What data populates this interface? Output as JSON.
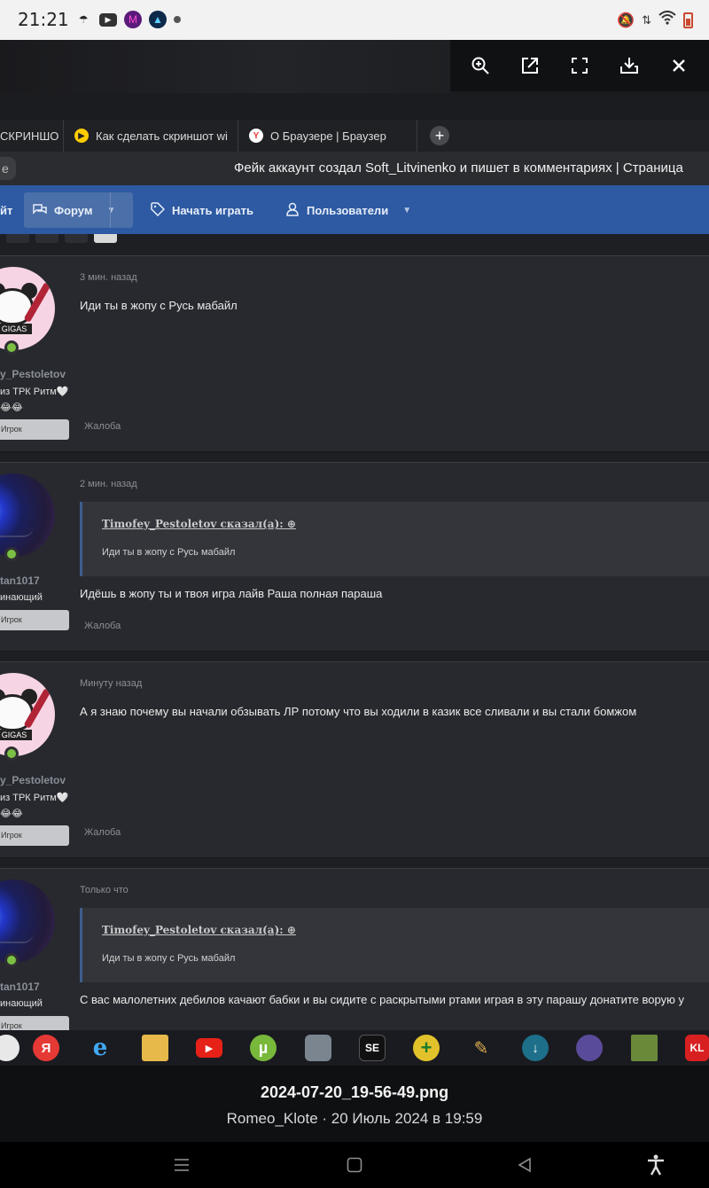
{
  "status_bar": {
    "time": "21:21",
    "icons": [
      "umbrella-icon",
      "youtube-icon",
      "app-icon-purple",
      "app-icon-blue",
      "dot-icon"
    ],
    "right_icons": [
      "mute-icon",
      "data-icon",
      "wifi-icon",
      "battery-icon"
    ]
  },
  "viewer": {
    "actions": [
      "zoom-in-icon",
      "open-external-icon",
      "fullscreen-icon",
      "download-icon",
      "close-icon"
    ]
  },
  "browser": {
    "tabs": [
      {
        "label": "СКРИНШО",
        "icon": "none"
      },
      {
        "label": "Как сделать скриншот wi",
        "icon": "yandex-play-icon"
      },
      {
        "label": "О Браузере | Браузер",
        "icon": "yandex-browser-icon"
      }
    ],
    "new_tab": "+",
    "address_left": "е",
    "page_title": "Фейк аккаунт создал Soft_Litvinenko и пишет в комментариях | Страница"
  },
  "forum_nav": {
    "left_fragment": "йт",
    "items": [
      {
        "label": "Форум",
        "icon": "chat-icon",
        "active": true
      },
      {
        "label": "Начать играть",
        "icon": "tag-icon",
        "active": false
      },
      {
        "label": "Пользователи",
        "icon": "user-icon",
        "active": false
      }
    ]
  },
  "posts": [
    {
      "avatar": "panda",
      "username": "y_Pestoletov",
      "user_title": "из ТРК Ритм🤍",
      "user_title2": "😂😂",
      "role": "Игрок",
      "time": "3 мин. назад",
      "text": "Иди ты в жопу с Русь мабайл",
      "report": "Жалоба"
    },
    {
      "avatar": "police",
      "username": "tan1017",
      "user_title": "инающий",
      "role": "Игрок",
      "time": "2 мин. назад",
      "quote_author": "Timofey_Pestoletov сказал(а):",
      "quote_text": "Иди ты в жопу с Русь мабайл",
      "text": "Идёшь в жопу ты и твоя игра лайв Раша полная параша",
      "report": "Жалоба"
    },
    {
      "avatar": "panda",
      "username": "y_Pestoletov",
      "user_title": "из ТРК Ритм🤍",
      "user_title2": "😂😂",
      "role": "Игрок",
      "time": "Минуту назад",
      "text": "А я знаю почему вы начали обзывать ЛР потому что вы ходили в казик все сливали и вы стали бомжом",
      "report": "Жалоба"
    },
    {
      "avatar": "police",
      "username": "tan1017",
      "user_title": "инающий",
      "role": "Игрок",
      "time": "Только что",
      "quote_author": "Timofey_Pestoletov сказал(а):",
      "quote_text": "Иди ты в жопу с Русь мабайл",
      "text": "С вас малолетних дебилов качают бабки и вы сидите с раскрытыми ртами играя в эту парашу донатите ворую у"
    }
  ],
  "taskbar": {
    "apps": [
      "app-circle-icon",
      "yandex-icon",
      "ie-icon",
      "explorer-icon",
      "youtube-icon",
      "utorrent-icon",
      "shield-app-icon",
      "se-icon",
      "plus-app-icon",
      "broom-icon",
      "download-app-icon",
      "space-icon",
      "minecraft-icon",
      "kl-icon"
    ],
    "yandex_label": "Я",
    "se_label": "SE",
    "kl_label": "KL"
  },
  "caption": {
    "file_name": "2024-07-20_19-56-49.png",
    "subtitle": "Romeo_Klote · 20 Июль 2024 в 19:59"
  },
  "android_nav": [
    "menu-icon",
    "home-icon",
    "back-icon",
    "accessibility-icon"
  ]
}
